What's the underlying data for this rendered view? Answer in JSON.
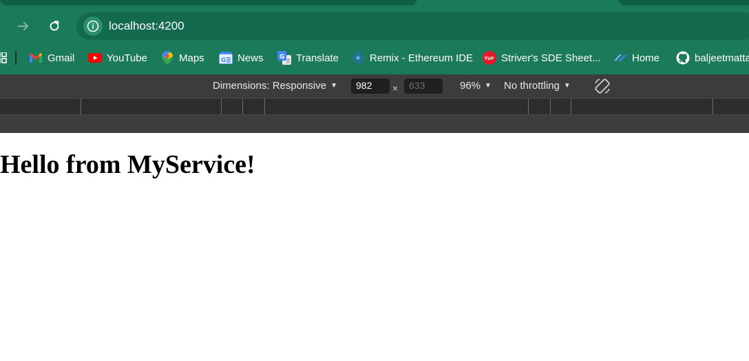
{
  "browser": {
    "url": "localhost:4200",
    "icons": {
      "forward": "arrow-right-icon",
      "reload": "reload-icon",
      "site_info": "info-icon"
    }
  },
  "bookmarks": [
    {
      "label": "Gmail",
      "icon": "gmail-icon"
    },
    {
      "label": "YouTube",
      "icon": "youtube-icon"
    },
    {
      "label": "Maps",
      "icon": "maps-icon"
    },
    {
      "label": "News",
      "icon": "news-icon"
    },
    {
      "label": "Translate",
      "icon": "translate-icon"
    },
    {
      "label": "Remix - Ethereum IDE",
      "icon": "remix-icon"
    },
    {
      "label": "Striver's SDE Sheet...",
      "icon": "tuf-icon"
    },
    {
      "label": "Home",
      "icon": "home-link-icon"
    },
    {
      "label": "baljeetmatta",
      "icon": "github-icon"
    }
  ],
  "devtools": {
    "dimensions_label": "Dimensions: Responsive",
    "width": "982",
    "height_placeholder": "633",
    "times": "×",
    "zoom": "96%",
    "throttling": "No throttling",
    "caret": "▼"
  },
  "page": {
    "heading": "Hello from MyService!"
  },
  "colors": {
    "chrome_green": "#1b7a5a",
    "omnibox_green": "#136a4e",
    "devtools_bar": "#3c3c3c"
  }
}
